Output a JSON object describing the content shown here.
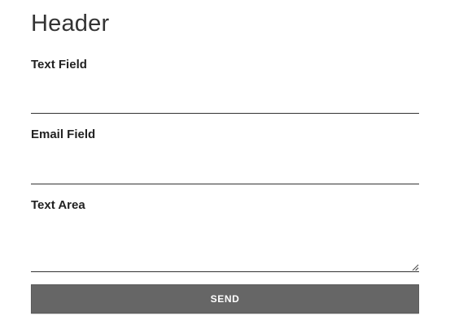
{
  "form": {
    "header": "Header",
    "fields": [
      {
        "label": "Text Field",
        "type": "text",
        "value": "",
        "placeholder": ""
      },
      {
        "label": "Email Field",
        "type": "email",
        "value": "",
        "placeholder": ""
      },
      {
        "label": "Text Area",
        "type": "textarea",
        "value": "",
        "placeholder": ""
      }
    ],
    "submit_label": "SEND"
  },
  "colors": {
    "text": "#222222",
    "button_bg": "#666666",
    "button_text": "#ffffff",
    "underline": "#333333"
  },
  "icons": {
    "textarea_resize": "resize-grip-icon"
  }
}
